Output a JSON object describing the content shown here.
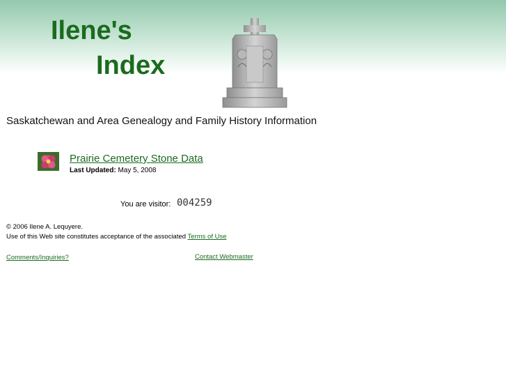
{
  "header": {
    "title_line1": "Ilene's",
    "title_line2": "Index"
  },
  "tagline": "Saskatchewan and Area Genealogy and Family History Information",
  "featured": {
    "link_text": "Prairie Cemetery Stone Data",
    "updated_label": "Last Updated:",
    "updated_value": "May 5, 2008"
  },
  "visitor": {
    "label": "You are visitor:",
    "count": "004259"
  },
  "footer": {
    "copyright": "© 2006 Ilene A. Lequyere.",
    "terms_prefix": "Use of this Web site constitutes acceptance of the associated",
    "terms_link": "Terms of Use",
    "comments_link": "Comments/Inquiries?",
    "webmaster_link": "Contact Webmaster"
  },
  "colors": {
    "brand_green": "#1b6b1f",
    "header_gradient_top": "#93c8ae"
  },
  "icons": {
    "tombstone": "tombstone-cross-image",
    "flower": "flower-thumbnail"
  }
}
